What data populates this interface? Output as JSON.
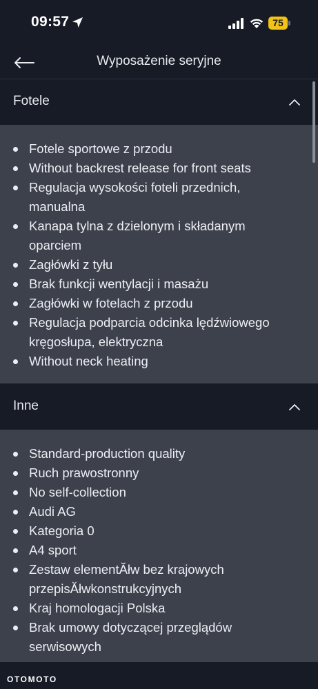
{
  "status_bar": {
    "time": "09:57",
    "battery_level": "75"
  },
  "header": {
    "title": "Wyposażenie seryjne"
  },
  "sections": [
    {
      "title": "Fotele",
      "expanded": true,
      "items": [
        "Fotele sportowe z przodu",
        "Without backrest release for front seats",
        "Regulacja wysokości foteli przednich, manualna",
        "Kanapa tylna z dzielonym i składanym oparciem",
        "Zagłówki z tyłu",
        "Brak funkcji wentylacji i masażu",
        "Zagłówki w fotelach z przodu",
        "Regulacja podparcia odcinka lędźwiowego kręgosłupa, elektryczna",
        "Without neck heating"
      ]
    },
    {
      "title": "Inne",
      "expanded": true,
      "items": [
        "Standard-production quality",
        "Ruch prawostronny",
        "No self-collection",
        "Audi AG",
        "Kategoria 0",
        "A4 sport",
        "Zestaw elementĂłw bez krajowych przepisĂłwkonstrukcyjnych",
        "Kraj homologacji Polska",
        "Brak umowy dotyczącej przeglądów serwisowych"
      ]
    }
  ],
  "footer": {
    "logo_text": "OTOMOTO"
  },
  "colors": {
    "page_background": "#161b26",
    "section_body_background": "#3d414c",
    "battery_accent": "#f2c316",
    "text": "#e9ebef"
  },
  "icons": {
    "status": [
      "location-arrow-icon",
      "cellular-signal-icon",
      "wifi-icon",
      "battery-icon"
    ],
    "back": "arrow-left-icon",
    "section_toggle": "chevron-up-icon"
  }
}
